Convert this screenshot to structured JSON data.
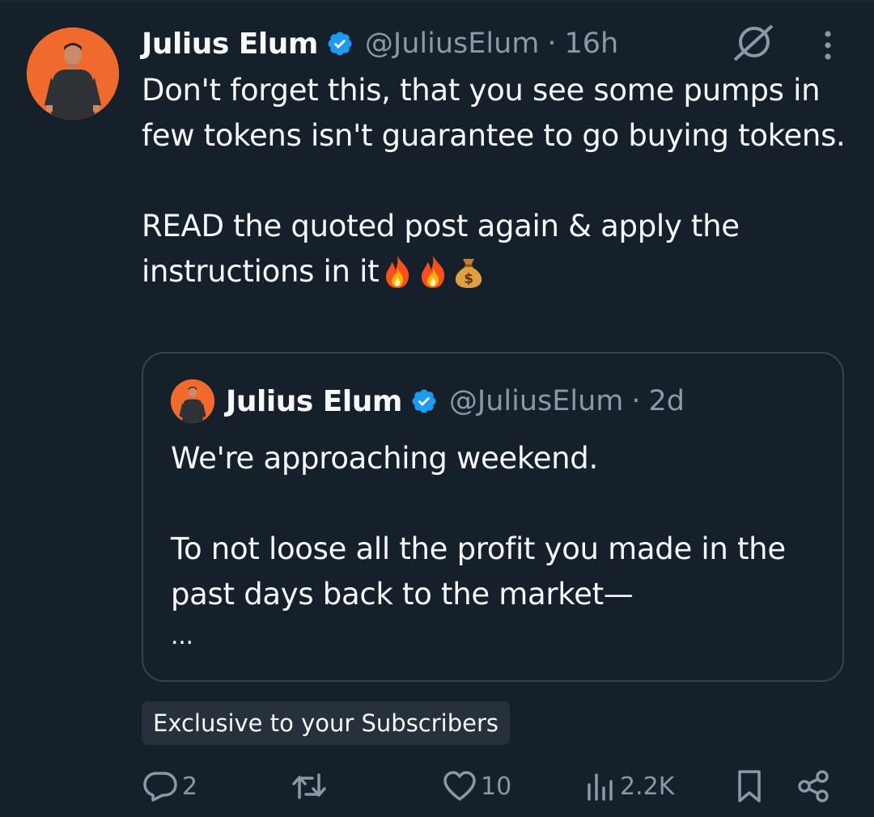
{
  "post": {
    "author_name": "Julius Elum",
    "handle": "@JuliusElum",
    "separator": "·",
    "time": "16h",
    "paragraphs": [
      "Don't forget this, that you see some pumps in few tokens isn't guarantee to go buying tokens.",
      "READ the quoted post again & apply the instructions in it"
    ],
    "emojis": [
      "fire",
      "fire",
      "money-bag"
    ]
  },
  "quote": {
    "author_name": "Julius Elum",
    "handle": "@JuliusElum",
    "separator": "·",
    "time": "2d",
    "paragraphs": [
      "We're approaching weekend.",
      "To not loose all the profit you made in the past days back to the market—"
    ],
    "ellipsis": "..."
  },
  "badge": "Exclusive to your Subscribers",
  "actions": {
    "replies": "2",
    "reposts": "",
    "likes": "10",
    "views": "2.2K"
  },
  "icons": {
    "verified": "verified-badge-icon",
    "grok": "grok-icon",
    "more": "more-vertical-icon",
    "reply": "reply-icon",
    "repost": "repost-icon",
    "like": "heart-icon",
    "views": "views-chart-icon",
    "bookmark": "bookmark-icon",
    "share": "share-icon"
  },
  "colors": {
    "background": "#15202b",
    "text": "#f7f9f9",
    "secondary": "#8b98a5",
    "verified": "#1d9bf0",
    "avatar_bg": "#ef6a2c",
    "border": "#38444d"
  }
}
